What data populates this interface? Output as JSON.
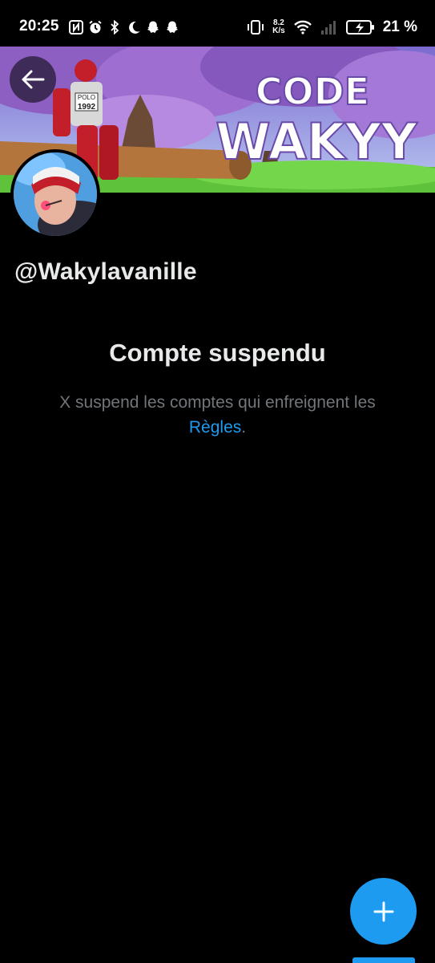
{
  "status_bar": {
    "time": "20:25",
    "net_speed_value": "8.2",
    "net_speed_unit": "K/s",
    "battery_percent": "21 %",
    "left_icons": [
      "nfc-icon",
      "alarm-icon",
      "bluetooth-icon",
      "moon-icon",
      "snapchat-icon",
      "snapchat-icon"
    ],
    "right_icons": [
      "vibrate-icon",
      "wifi-icon",
      "signal-icon",
      "battery-charging-icon"
    ]
  },
  "banner": {
    "title_line1": "CODE",
    "title_line2": "WAKYY",
    "bib_top": "POLO",
    "bib_number": "1992"
  },
  "profile": {
    "handle": "@Wakylavanille"
  },
  "suspension": {
    "title": "Compte suspendu",
    "message": "X suspend les comptes qui enfreignent les",
    "link_label": "Règles",
    "trailing": "."
  },
  "fab": {
    "icon": "plus-icon"
  },
  "colors": {
    "background": "#000000",
    "accent": "#1d9bf0",
    "text_primary": "#e7e9ea",
    "text_secondary": "#71767b"
  }
}
